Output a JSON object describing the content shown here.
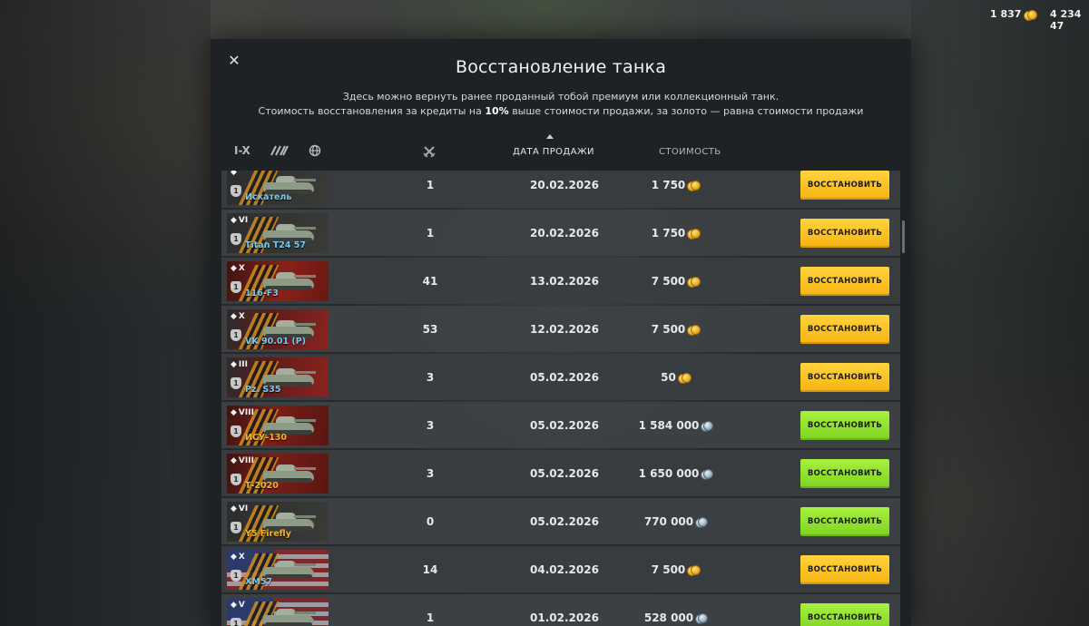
{
  "currency": {
    "gold": "1 837",
    "credits": "4 234 47"
  },
  "modal": {
    "title": "Восстановление танка",
    "desc_line1": "Здесь можно вернуть ранее проданный тобой премиум или коллекционный танк.",
    "desc_line2_a": "Стоимость восстановления за кредиты на ",
    "desc_line2_b": "10%",
    "desc_line2_c": " выше стоимости продажи, за золото — равна стоимости продажи"
  },
  "filters": {
    "tier": "I-X",
    "class_icon": "tank-class-icon",
    "nation_icon": "globe-icon"
  },
  "columns": {
    "battles_icon": "crossed-swords-icon",
    "date": "ДАТА ПРОДАЖИ",
    "cost": "СТОИМОСТЬ"
  },
  "rows": [
    {
      "tier": "",
      "name": "Искатель",
      "battles": "1",
      "date": "20.02.2026",
      "cost": "1 750",
      "currency": "gold",
      "button": "ВОССТАНОВИТЬ",
      "flag": "intl",
      "gold_name": false
    },
    {
      "tier": "VI",
      "name": "Titan T24 57",
      "battles": "1",
      "date": "20.02.2026",
      "cost": "1 750",
      "currency": "gold",
      "button": "ВОССТАНОВИТЬ",
      "flag": "intl",
      "gold_name": false
    },
    {
      "tier": "X",
      "name": "116-F3",
      "battles": "41",
      "date": "13.02.2026",
      "cost": "7 500",
      "currency": "gold",
      "button": "ВОССТАНОВИТЬ",
      "flag": "china",
      "gold_name": false
    },
    {
      "tier": "X",
      "name": "VK 90.01 (P)",
      "battles": "53",
      "date": "12.02.2026",
      "cost": "7 500",
      "currency": "gold",
      "button": "ВОССТАНОВИТЬ",
      "flag": "germany",
      "gold_name": false
    },
    {
      "tier": "III",
      "name": "Pz. S35",
      "battles": "3",
      "date": "05.02.2026",
      "cost": "50",
      "currency": "gold",
      "button": "ВОССТАНОВИТЬ",
      "flag": "germany",
      "gold_name": false
    },
    {
      "tier": "VIII",
      "name": "ИСУ-130",
      "battles": "3",
      "date": "05.02.2026",
      "cost": "1 584 000",
      "currency": "credits",
      "button": "ВОССТАНОВИТЬ",
      "flag": "ussr",
      "gold_name": true
    },
    {
      "tier": "VIII",
      "name": "Т-2020",
      "battles": "3",
      "date": "05.02.2026",
      "cost": "1 650 000",
      "currency": "credits",
      "button": "ВОССТАНОВИТЬ",
      "flag": "ussr",
      "gold_name": true
    },
    {
      "tier": "VI",
      "name": "Y5 Firefly",
      "battles": "0",
      "date": "05.02.2026",
      "cost": "770 000",
      "currency": "credits",
      "button": "ВОССТАНОВИТЬ",
      "flag": "intl",
      "gold_name": true
    },
    {
      "tier": "X",
      "name": "XM57",
      "battles": "14",
      "date": "04.02.2026",
      "cost": "7 500",
      "currency": "gold",
      "button": "ВОССТАНОВИТЬ",
      "flag": "usa",
      "gold_name": false
    },
    {
      "tier": "V",
      "name": "T14",
      "battles": "1",
      "date": "01.02.2026",
      "cost": "528 000",
      "currency": "credits",
      "button": "ВОССТАНОВИТЬ",
      "flag": "usa",
      "gold_name": true
    }
  ]
}
